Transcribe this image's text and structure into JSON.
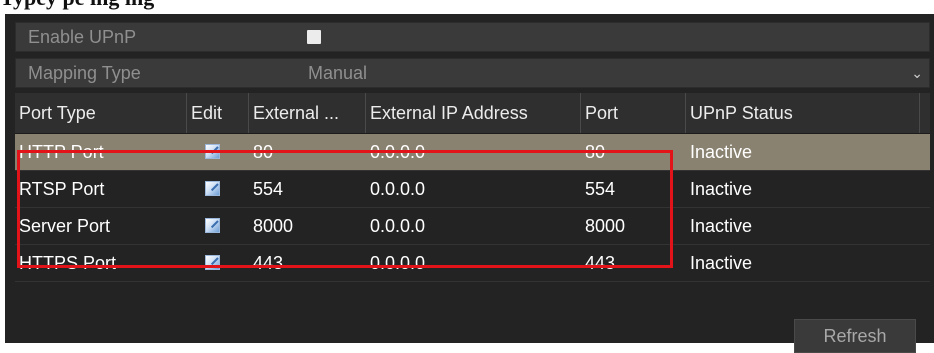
{
  "heading": "Typey pe  ing ing",
  "settings": {
    "enable_upnp_label": "Enable UPnP",
    "enable_upnp_checked": true,
    "mapping_type_label": "Mapping Type",
    "mapping_type_value": "Manual"
  },
  "table": {
    "columns": [
      "Port Type",
      "Edit",
      "External ...",
      "External IP Address",
      "Port",
      "UPnP Status"
    ],
    "rows": [
      {
        "port_type": "HTTP Port",
        "external_port": "80",
        "external_ip": "0.0.0.0",
        "port": "80",
        "status": "Inactive",
        "selected": true
      },
      {
        "port_type": "RTSP Port",
        "external_port": "554",
        "external_ip": "0.0.0.0",
        "port": "554",
        "status": "Inactive",
        "selected": false
      },
      {
        "port_type": "Server Port",
        "external_port": "8000",
        "external_ip": "0.0.0.0",
        "port": "8000",
        "status": "Inactive",
        "selected": false
      },
      {
        "port_type": "HTTPS Port",
        "external_port": "443",
        "external_ip": "0.0.0.0",
        "port": "443",
        "status": "Inactive",
        "selected": false
      }
    ]
  },
  "refresh_label": "Refresh",
  "colors": {
    "panel_bg": "#232323",
    "selected_row": "#8a8270",
    "highlight_border": "#e2141a"
  }
}
